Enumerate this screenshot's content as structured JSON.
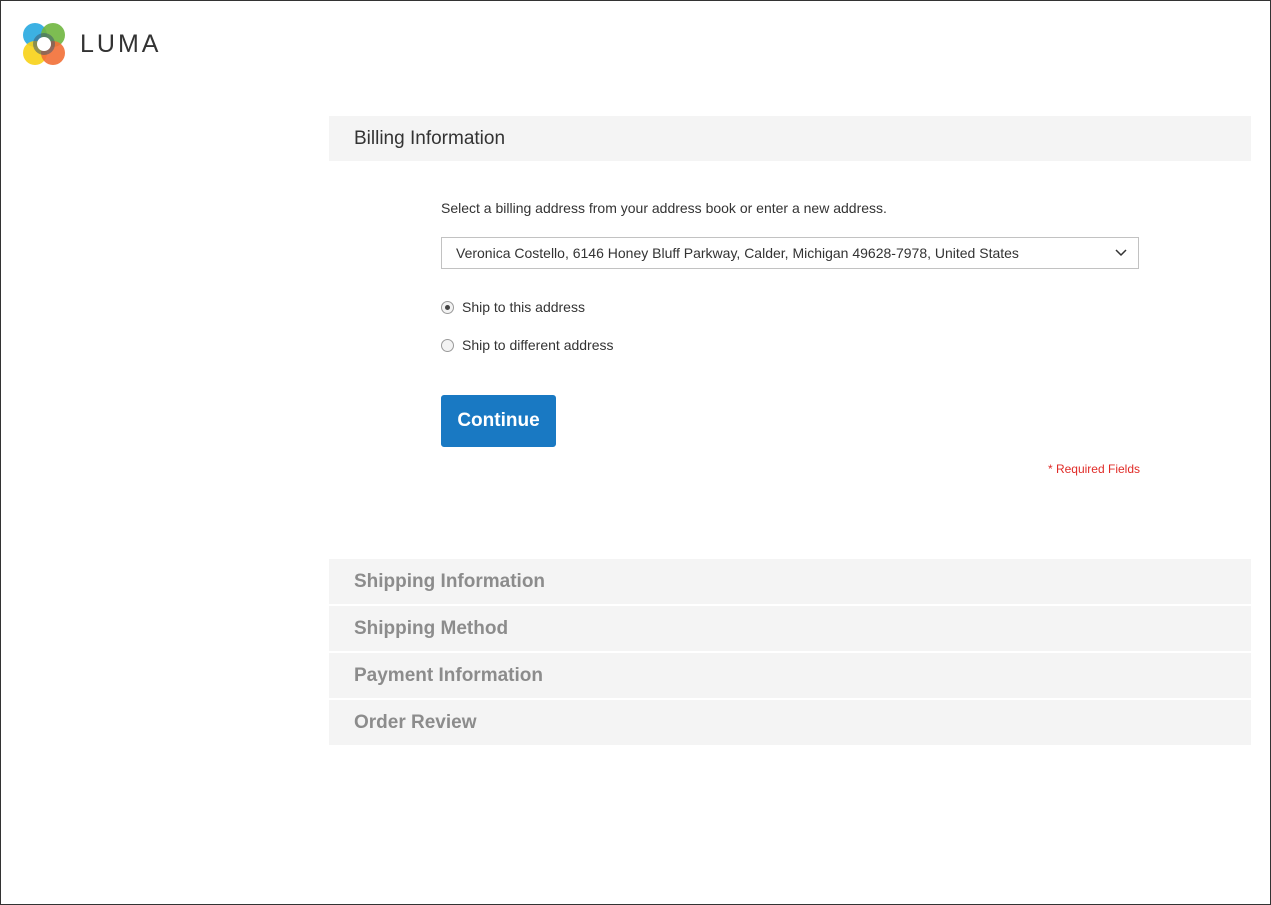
{
  "brand": {
    "name": "LUMA"
  },
  "billing": {
    "title": "Billing Information",
    "intro": "Select a billing address from your address book or enter a new address.",
    "address_select": {
      "selected": "Veronica Costello, 6146 Honey Bluff Parkway, Calder, Michigan 49628-7978, United States"
    },
    "ship_options": [
      {
        "label": "Ship to this address",
        "checked": true
      },
      {
        "label": "Ship to different address",
        "checked": false
      }
    ],
    "continue_label": "Continue",
    "required_note": "* Required Fields"
  },
  "steps": [
    {
      "label": "Shipping Information"
    },
    {
      "label": "Shipping Method"
    },
    {
      "label": "Payment Information"
    },
    {
      "label": "Order Review"
    }
  ],
  "colors": {
    "accent": "#1979c3",
    "required": "#e02b27",
    "step_bg": "#f4f4f4",
    "inactive_text": "#8c8c8c"
  }
}
